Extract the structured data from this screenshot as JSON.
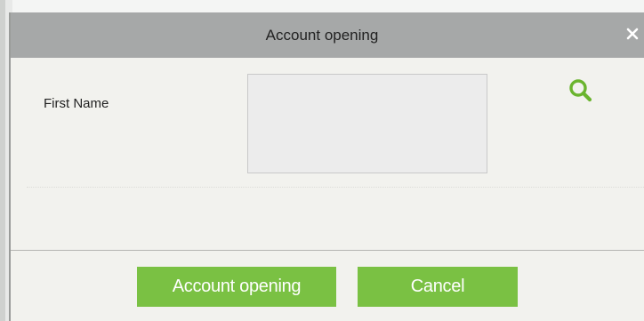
{
  "dialog": {
    "title": "Account opening",
    "close_icon": "close-icon"
  },
  "form": {
    "first_name_label": "First Name",
    "first_name_value": "",
    "search_icon": "search-icon"
  },
  "footer": {
    "confirm_label": "Account opening",
    "cancel_label": "Cancel"
  },
  "colors": {
    "title_bar": "#a6a8a8",
    "dialog_bg": "#f2f2ee",
    "accent_green": "#7ac143",
    "input_bg": "#ececec"
  }
}
